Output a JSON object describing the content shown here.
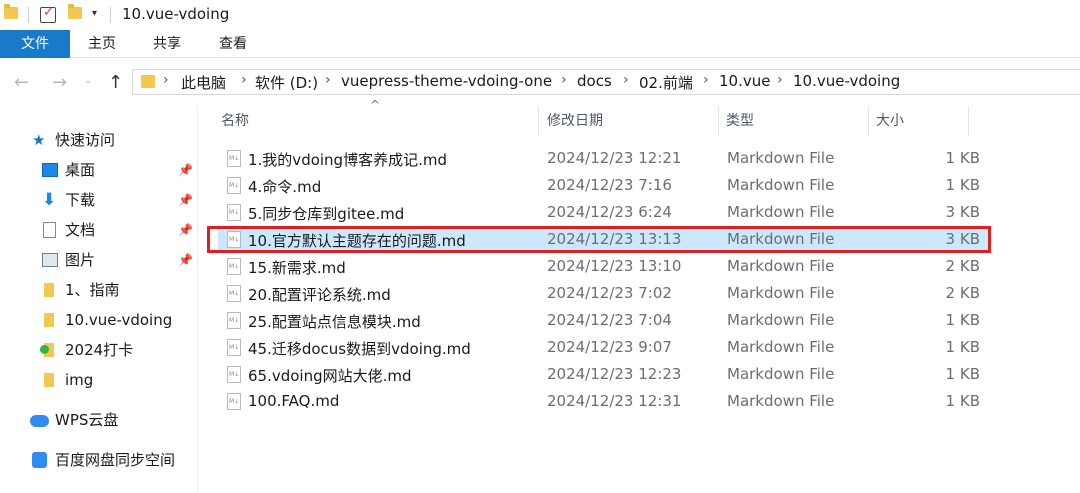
{
  "window": {
    "title": "10.vue-vdoing"
  },
  "ribbon": {
    "tabs": [
      "文件",
      "主页",
      "共享",
      "查看"
    ]
  },
  "address": {
    "crumbs": [
      "此电脑",
      "软件 (D:)",
      "vuepress-theme-vdoing-one",
      "docs",
      "02.前端",
      "10.vue",
      "10.vue-vdoing"
    ]
  },
  "sidebar": {
    "items": [
      {
        "label": "快速访问",
        "icon": "star-icon",
        "pinned": false
      },
      {
        "label": "桌面",
        "icon": "desktop-icon",
        "pinned": true
      },
      {
        "label": "下载",
        "icon": "download-icon",
        "pinned": true
      },
      {
        "label": "文档",
        "icon": "document-icon",
        "pinned": true
      },
      {
        "label": "图片",
        "icon": "picture-icon",
        "pinned": true
      },
      {
        "label": "1、指南",
        "icon": "folder-icon",
        "pinned": false
      },
      {
        "label": "10.vue-vdoing",
        "icon": "folder-icon",
        "pinned": false
      },
      {
        "label": "2024打卡",
        "icon": "folder-sync-icon",
        "pinned": false
      },
      {
        "label": "img",
        "icon": "folder-icon",
        "pinned": false
      },
      {
        "label": "WPS云盘",
        "icon": "cloud-icon",
        "pinned": false
      },
      {
        "label": "百度网盘同步空间",
        "icon": "baidu-netdisk-icon",
        "pinned": false
      }
    ]
  },
  "columns": {
    "name": "名称",
    "date": "修改日期",
    "type": "类型",
    "size": "大小"
  },
  "files": [
    {
      "name": "1.我的vdoing博客养成记.md",
      "date": "2024/12/23 12:21",
      "type": "Markdown File",
      "size": "1 KB"
    },
    {
      "name": "4.命令.md",
      "date": "2024/12/23 7:16",
      "type": "Markdown File",
      "size": "1 KB"
    },
    {
      "name": "5.同步仓库到gitee.md",
      "date": "2024/12/23 6:24",
      "type": "Markdown File",
      "size": "3 KB"
    },
    {
      "name": "10.官方默认主题存在的问题.md",
      "date": "2024/12/23 13:13",
      "type": "Markdown File",
      "size": "3 KB"
    },
    {
      "name": "15.新需求.md",
      "date": "2024/12/23 13:10",
      "type": "Markdown File",
      "size": "2 KB"
    },
    {
      "name": "20.配置评论系统.md",
      "date": "2024/12/23 7:02",
      "type": "Markdown File",
      "size": "2 KB"
    },
    {
      "name": "25.配置站点信息模块.md",
      "date": "2024/12/23 7:04",
      "type": "Markdown File",
      "size": "1 KB"
    },
    {
      "name": "45.迁移docus数据到vdoing.md",
      "date": "2024/12/23 9:07",
      "type": "Markdown File",
      "size": "1 KB"
    },
    {
      "name": "65.vdoing网站大佬.md",
      "date": "2024/12/23 12:23",
      "type": "Markdown File",
      "size": "1 KB"
    },
    {
      "name": "100.FAQ.md",
      "date": "2024/12/23 12:31",
      "type": "Markdown File",
      "size": "1 KB"
    }
  ],
  "selected_index": 3,
  "colors": {
    "accent": "#1979ca",
    "selection": "#cce8ff",
    "highlight": "#e02020",
    "folder": "#f2c94c"
  }
}
